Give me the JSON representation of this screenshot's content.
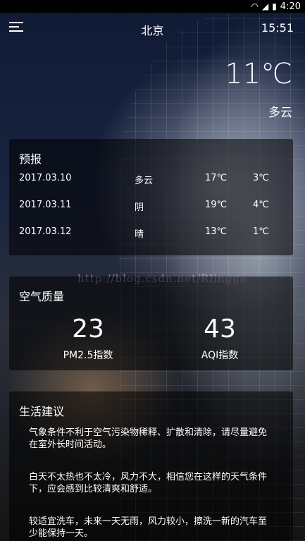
{
  "status_bar": {
    "time": "4:20",
    "icons": [
      "wifi-icon",
      "signal-icon",
      "battery-icon"
    ]
  },
  "header": {
    "city": "北京",
    "update_time": "15:51"
  },
  "now": {
    "temperature": "11℃",
    "condition": "多云"
  },
  "forecast": {
    "title": "预报",
    "rows": [
      {
        "date": "2017.03.10",
        "weather": "多云",
        "max": "17℃",
        "min": "3℃"
      },
      {
        "date": "2017.03.11",
        "weather": "阴",
        "max": "19℃",
        "min": "4℃"
      },
      {
        "date": "2017.03.12",
        "weather": "晴",
        "max": "13℃",
        "min": "1℃"
      }
    ]
  },
  "aqi": {
    "title": "空气质量",
    "items": [
      {
        "value": "23",
        "label": "PM2.5指数"
      },
      {
        "value": "43",
        "label": "AQI指数"
      }
    ]
  },
  "suggestion": {
    "title": "生活建议",
    "items": [
      "气象条件不利于空气污染物稀释、扩散和清除，请尽量避免在室外长时间活动。",
      "白天不太热也不太冷，风力不大，相信您在这样的天气条件下，应会感到比较清爽和舒适。",
      "较适宜洗车，未来一天无雨，风力较小，擦洗一新的汽车至少能保持一天。"
    ]
  },
  "watermark": "http://blog.csdn.net/Rlingge"
}
